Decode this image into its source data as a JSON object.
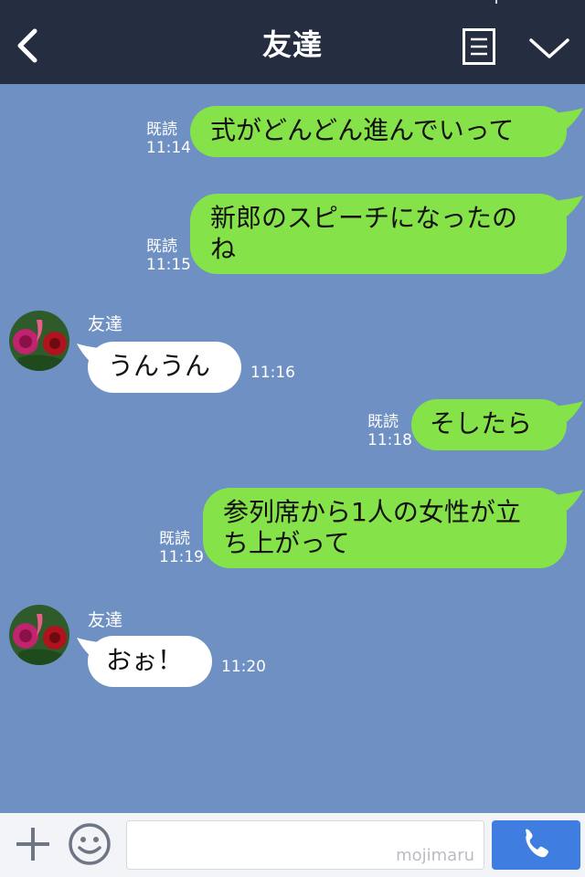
{
  "header": {
    "title": "友達"
  },
  "messages": [
    {
      "dir": "out",
      "text": "式がどんどん進んでいって",
      "read": "既読",
      "time": "11:14"
    },
    {
      "dir": "out",
      "text": "新郎のスピーチになったの\nね",
      "read": "既読",
      "time": "11:15"
    },
    {
      "dir": "in",
      "sender": "友達",
      "text": "うんうん",
      "time": "11:16"
    },
    {
      "dir": "out",
      "text": "そしたら",
      "read": "既読",
      "time": "11:18"
    },
    {
      "dir": "out",
      "text": "参列席から1人の女性が立\nち上がって",
      "read": "既読",
      "time": "11:19"
    },
    {
      "dir": "in",
      "sender": "友達",
      "text": "おぉ！",
      "time": "11:20"
    }
  ],
  "footer": {
    "watermark": "mojimaru"
  },
  "icons": [
    "back-arrow-icon",
    "menu-icon",
    "chevron-down-icon",
    "plus-icon",
    "smiley-icon",
    "phone-icon"
  ],
  "colors": {
    "header": "#252d41",
    "background": "#6f90c2",
    "bubble_out": "#85e249",
    "send": "#3f7de0"
  }
}
